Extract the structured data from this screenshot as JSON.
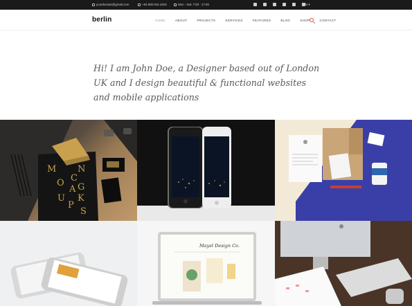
{
  "topbar": {
    "email": "yourdomain@gmail.com",
    "phone": "+94 808 916 1819",
    "hours": "Mon - Sat: 7:00 - 17:00",
    "language": "EN"
  },
  "header": {
    "logo": "berlin",
    "nav": [
      "HOME",
      "ABOUT",
      "PROJECTS",
      "SERVICES",
      "FEATURES",
      "BLOG",
      "SHOP",
      "CONTACT"
    ]
  },
  "hero": {
    "text": "Hi! I am John Doe, a Designer based out of London UK and I design beautiful & functional websites and mobile applications"
  },
  "portfolio": {
    "tile1_letters": [
      "M",
      "O",
      "N",
      "C",
      "U",
      "A",
      "N",
      "G",
      "K",
      "S",
      "P"
    ],
    "tile5_title": "Mayel Design Co."
  },
  "colors": {
    "topbar_bg": "#1a1a1a",
    "accent": "#d64d2a",
    "gold": "#c8a04e",
    "blue": "#3a3fa8"
  }
}
